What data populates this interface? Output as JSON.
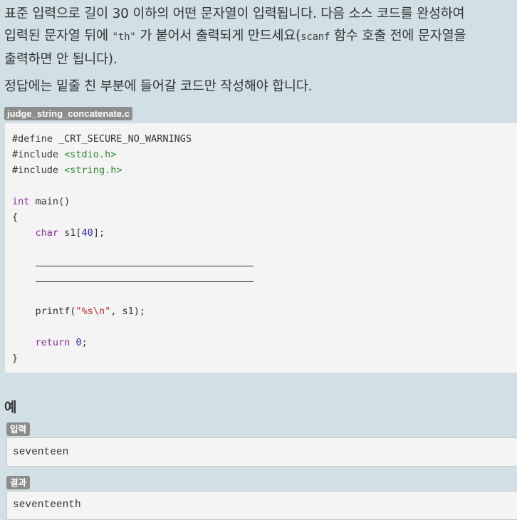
{
  "problem": {
    "line1": "표준 입력으로 길이 30 이하의 어떤 문자열이 입력됩니다. 다음 소스 코드를 완성하여",
    "line2_prefix": "입력된 문자열 뒤에 ",
    "line2_code": "\"th\"",
    "line2_mid": " 가 붙어서 출력되게 만드세요(",
    "line2_code2": "scanf",
    "line2_suffix": " 함수 호출 전에 문자열을",
    "line3": "출력하면 안 됩니다).",
    "instruction": "정답에는 밑줄 친 부분에 들어갈 코드만 작성해야 합니다."
  },
  "code_file": {
    "filename": "judge_string_concatenate.c",
    "define_directive": "#define",
    "define_name": " _CRT_SECURE_NO_WARNINGS",
    "include_directive": "#include",
    "include1_header": "<stdio.h>",
    "include2_header": "<string.h>",
    "int_kw": "int",
    "main_sig": " main()",
    "open_brace": "{",
    "char_kw": "char",
    "array_decl_name": " s1[",
    "array_size": "40",
    "array_decl_end": "];",
    "printf_call": "printf(",
    "format_str_a": "\"%s",
    "format_escape": "\\n",
    "format_str_b": "\"",
    "printf_args": ", s1);",
    "return_kw": "return",
    "return_value": "0",
    "return_end": ";",
    "close_brace": "}"
  },
  "example": {
    "heading": "예",
    "input_label": "입력",
    "input_value": "seventeen",
    "output_label": "결과",
    "output_value": "seventeenth"
  }
}
